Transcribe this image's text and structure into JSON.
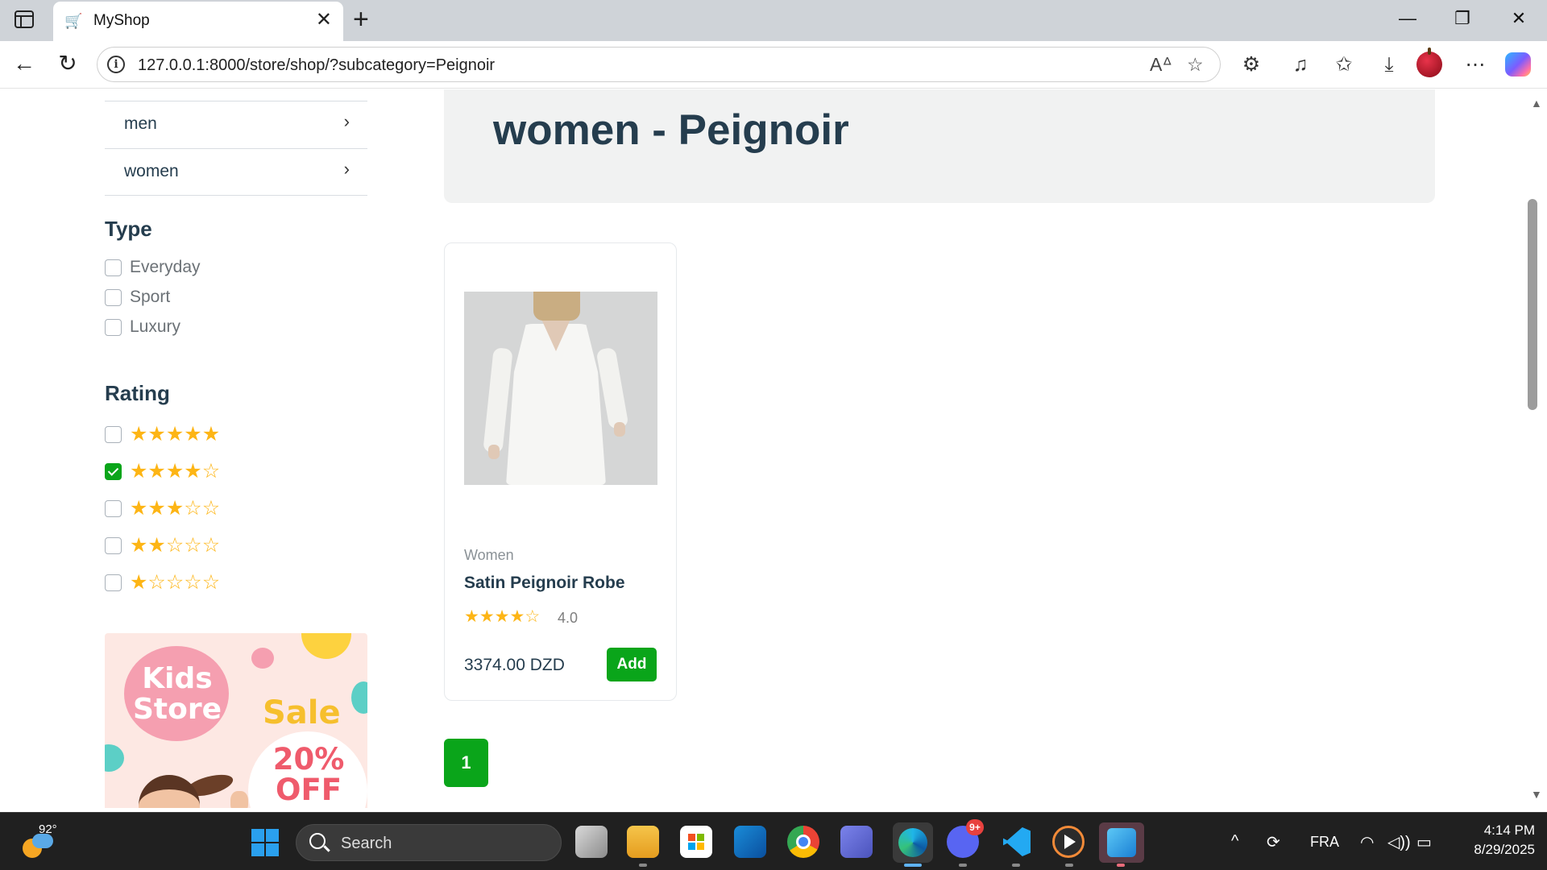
{
  "browser": {
    "tab_title": "MyShop",
    "url": "127.0.0.1:8000/store/shop/?subcategory=Peignoir"
  },
  "sidebar": {
    "categories": [
      {
        "label": "men"
      },
      {
        "label": "women"
      }
    ],
    "type_title": "Type",
    "types": [
      {
        "label": "Everyday",
        "checked": false
      },
      {
        "label": "Sport",
        "checked": false
      },
      {
        "label": "Luxury",
        "checked": false
      }
    ],
    "rating_title": "Rating",
    "ratings": [
      {
        "stars": 5,
        "checked": false
      },
      {
        "stars": 4,
        "checked": true
      },
      {
        "stars": 3,
        "checked": false
      },
      {
        "stars": 2,
        "checked": false
      },
      {
        "stars": 1,
        "checked": false
      }
    ],
    "banner": {
      "line1": "Kids",
      "line2": "Store",
      "sale": "Sale",
      "discount": "20%",
      "off": "OFF"
    }
  },
  "main": {
    "title": "women - Peignoir",
    "products": [
      {
        "category": "Women",
        "name": "Satin Peignoir Robe",
        "rating": 4.0,
        "rating_text": "4.0",
        "price": "3374.00 DZD",
        "add_label": "Add"
      }
    ],
    "pagination": {
      "current": "1"
    }
  },
  "taskbar": {
    "weather_temp": "92°",
    "search_label": "Search",
    "discord_badge": "9+",
    "language": "FRA",
    "time": "4:14 PM",
    "date": "8/29/2025"
  },
  "colors": {
    "accent_green": "#0aa51a",
    "star_yellow": "#fdb515",
    "heading": "#253d4e"
  }
}
